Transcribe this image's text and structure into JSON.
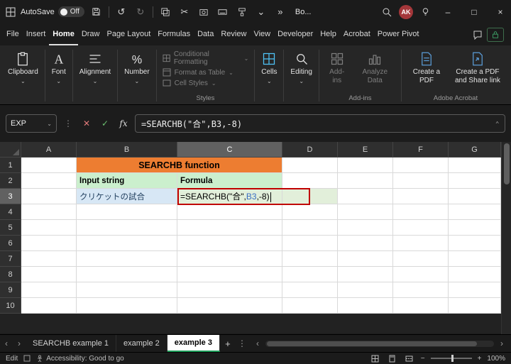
{
  "titlebar": {
    "autosave_label": "AutoSave",
    "autosave_state": "Off",
    "doc_title": "Bo...",
    "avatar_initials": "AK"
  },
  "menubar": {
    "items": [
      "File",
      "Insert",
      "Home",
      "Draw",
      "Page Layout",
      "Formulas",
      "Data",
      "Review",
      "View",
      "Developer",
      "Help",
      "Acrobat",
      "Power Pivot"
    ],
    "active": "Home"
  },
  "ribbon": {
    "clipboard": "Clipboard",
    "font": "Font",
    "alignment": "Alignment",
    "number": "Number",
    "styles_items": [
      "Conditional Formatting",
      "Format as Table",
      "Cell Styles"
    ],
    "styles_label": "Styles",
    "cells": "Cells",
    "editing": "Editing",
    "addins_button": "Add-ins",
    "analyze_data": "Analyze Data",
    "addins_label": "Add-ins",
    "create_pdf": "Create a PDF",
    "create_pdf_share": "Create a PDF and Share link",
    "acrobat_label": "Adobe Acrobat"
  },
  "formula_bar": {
    "name_box": "EXP",
    "fx": "fx",
    "formula": "=SEARCHB(\"合\",B3,-8)"
  },
  "grid": {
    "col_headers": [
      "A",
      "B",
      "C",
      "D",
      "E",
      "F",
      "G"
    ],
    "row_headers": [
      "1",
      "2",
      "3",
      "4",
      "5",
      "6",
      "7",
      "8",
      "9",
      "10"
    ],
    "title_cell": "SEARCHB function",
    "input_header": "Input string",
    "formula_header": "Formula",
    "input_value": "クリケットの試合",
    "formula_prefix": "=SEARCHB(\"合\",",
    "formula_ref": "B3",
    "formula_suffix": ",-8)",
    "selected_column": "C",
    "selected_row": "3"
  },
  "sheet_tabs": {
    "tab1": "SEARCHB example 1",
    "tab2": "example 2",
    "tab3": "example 3",
    "active": "example 3"
  },
  "status_bar": {
    "mode": "Edit",
    "accessibility": "Accessibility: Good to go",
    "zoom": "100%"
  },
  "icons": {
    "undo": "↺",
    "redo": "↻",
    "cut": "✂",
    "chevron": "⌄",
    "overflow": "»",
    "kebab": "⋮",
    "cancel": "✕",
    "enter": "✓",
    "minimize": "–",
    "maximize": "□",
    "close": "×",
    "tab_prev": "‹",
    "tab_next": "›",
    "new_sheet": "+",
    "zoom_out": "−",
    "zoom_in": "+"
  },
  "colors": {
    "title_fill": "#ED7D31",
    "header_fill": "#CBEFCD",
    "input_fill": "#D7E7F5",
    "formula_fill": "#E2EFDA",
    "reference_blue": "#3b6fc4",
    "edit_border_red": "#C00000",
    "accent_green": "#1e9e5a",
    "avatar_red": "#a4373a"
  }
}
